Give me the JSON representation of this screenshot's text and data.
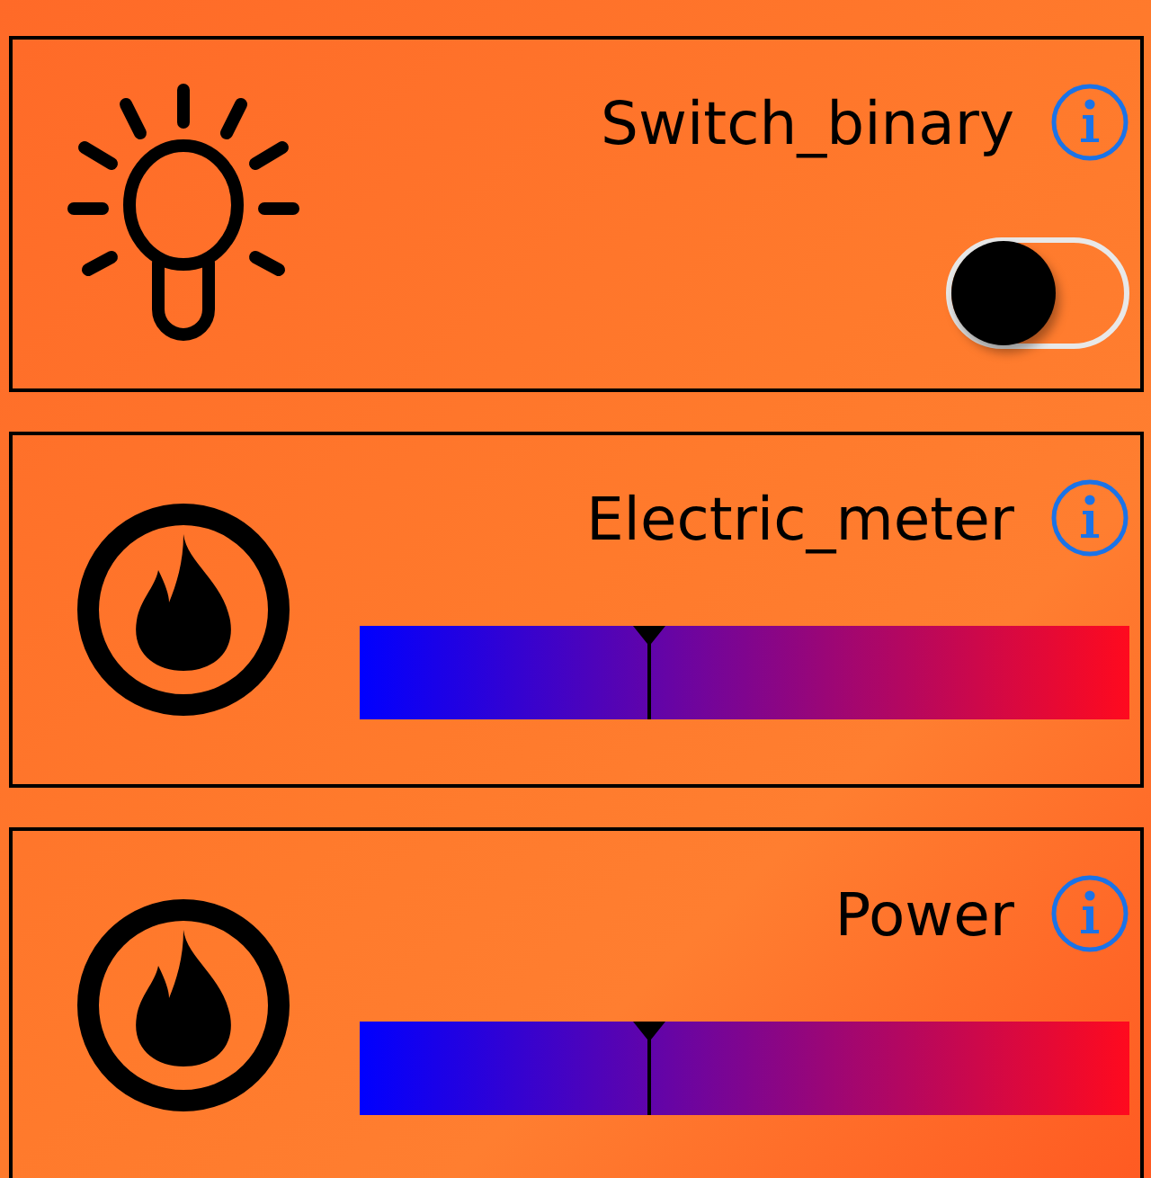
{
  "devices": [
    {
      "kind": "switch",
      "title": "Switch_binary",
      "on": false
    },
    {
      "kind": "meter",
      "title": "Electric_meter",
      "level": 0.376
    },
    {
      "kind": "meter",
      "title": "Power",
      "level": 0.376
    }
  ]
}
